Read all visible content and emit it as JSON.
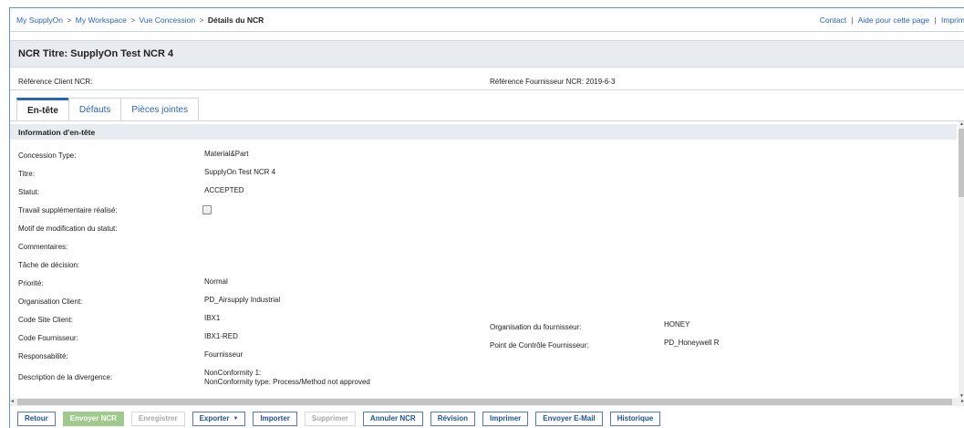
{
  "breadcrumb": {
    "items": [
      "My SupplyOn",
      "My Workspace",
      "Vue Concession"
    ],
    "current": "Détails du NCR",
    "separator": ">"
  },
  "toplinks": {
    "contact": "Contact",
    "help": "Aide pour cette page",
    "print": "Imprim",
    "separator": "|"
  },
  "title": "NCR Titre: SupplyOn Test NCR 4",
  "references": {
    "client": "Référence Client NCR:",
    "supplier": "Référence Fournisseur NCR: 2019-6-3"
  },
  "tabs": [
    {
      "label": "En-tête",
      "active": true
    },
    {
      "label": "Défauts",
      "active": false
    },
    {
      "label": "Pièces jointes",
      "active": false
    }
  ],
  "section": {
    "header": "Information d'en-tête"
  },
  "fields": {
    "concession_type": {
      "label": "Concession Type:",
      "value": "Material&Part"
    },
    "titre": {
      "label": "Titre:",
      "value": "SupplyOn Test NCR 4"
    },
    "statut": {
      "label": "Statut:",
      "value": "ACCEPTED"
    },
    "travail": {
      "label": "Travail supplémentaire réalisé:",
      "checked": false
    },
    "motif": {
      "label": "Motif de modification du statut:",
      "value": ""
    },
    "commentaires": {
      "label": "Commentaires:",
      "value": ""
    },
    "tache": {
      "label": "Tâche de décision:",
      "value": ""
    },
    "priorite": {
      "label": "Priorité:",
      "value": "Normal"
    },
    "org_client": {
      "label": "Organisation Client:",
      "value": "PD_Airsupply Industrial"
    },
    "site_client": {
      "label": "Code Site Client:",
      "value": "IBX1"
    },
    "code_fournisseur": {
      "label": "Code Fournisseur:",
      "value": "IBX1-RED"
    },
    "responsabilite": {
      "label": "Responsabilité:",
      "value": "Fournisseur"
    },
    "description": {
      "label": "Description de la divergence:",
      "line1": "NonConformity 1:",
      "line2": "NonConformity type: Process/Method not approved"
    },
    "org_fournisseur": {
      "label": "Organisation du fournisseur:",
      "value": "HONEY"
    },
    "point_controle": {
      "label": "Point de Contrôle Fournisseur:",
      "value": "PD_Honeywell R"
    }
  },
  "buttons": {
    "retour": "Retour",
    "envoyer_ncr": "Envoyer NCR",
    "enregistrer": "Enregistrer",
    "exporter": "Exporter",
    "importer": "Importer",
    "supprimer": "Supprimer",
    "annuler": "Annuler NCR",
    "revision": "Révision",
    "imprimer": "Imprimer",
    "email": "Envoyer E-Mail",
    "historique": "Historique"
  },
  "colors": {
    "link": "#2a64b5",
    "primary_button": "#9fc98d",
    "header_bg": "#e8ebef"
  }
}
